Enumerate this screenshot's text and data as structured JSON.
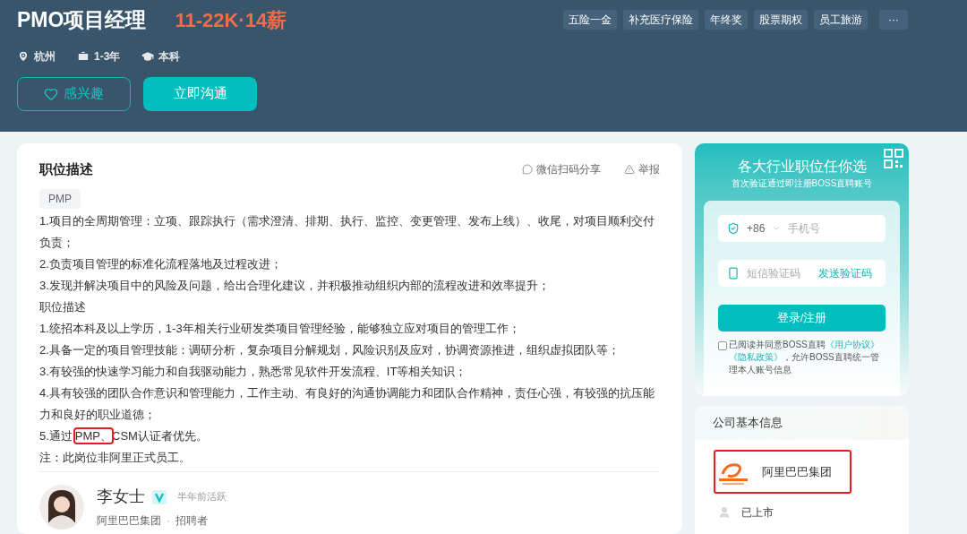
{
  "job": {
    "title": "PMO项目经理",
    "salary": "11-22K·14薪",
    "benefits": [
      "五险一金",
      "补充医疗保险",
      "年终奖",
      "股票期权",
      "员工旅游"
    ],
    "more": "···",
    "facts": [
      {
        "kind": "location",
        "text": "杭州"
      },
      {
        "kind": "experience",
        "text": "1-3年"
      },
      {
        "kind": "degree",
        "text": "本科"
      }
    ],
    "interest_button": "感兴趣",
    "chat_button": "立即沟通"
  },
  "description": {
    "title": "职位描述",
    "share": "微信扫码分享",
    "report": "举报",
    "tag": "PMP",
    "lines": [
      {
        "text": "1.项目的全周期管理：立项、跟踪执行（需求澄清、排期、执行、监控、变更管理、发布上线）、收尾，对项目顺利交付负责；"
      },
      {
        "text": "2.负责项目管理的标准化流程落地及过程改进；"
      },
      {
        "text": "3.发现并解决项目中的风险及问题，给出合理化建议，并积极推动组织内部的流程改进和效率提升；"
      },
      {
        "text": "职位描述"
      },
      {
        "text": "1.统招本科及以上学历，1-3年相关行业研发类项目管理经验，能够独立应对项目的管理工作；"
      },
      {
        "text": "2.具备一定的项目管理技能：调研分析，复杂项目分解规划，风险识别及应对，协调资源推进，组织虚拟团队等；"
      },
      {
        "text": "3.有较强的快速学习能力和自我驱动能力，熟悉常见软件开发流程、IT等相关知识；"
      },
      {
        "text": "4.具有较强的团队合作意识和管理能力，工作主动、有良好的沟通协调能力和团队合作精神，责任心强，有较强的抗压能力和良好的职业道德；"
      },
      {
        "text": "5.通过",
        "highlighted": "PMP、",
        "after": "CSM认证者优先。"
      },
      {
        "text": "注：此岗位非阿里正式员工。"
      }
    ]
  },
  "recruiter": {
    "name": "李女士",
    "verified": true,
    "active": "半年前活跃",
    "company": "阿里巴巴集团",
    "separator": "·",
    "role": "招聘者"
  },
  "login": {
    "title": "各大行业职位任你选",
    "subtitle": "首次验证通过即注册BOSS直聘账号",
    "country_code": "+86",
    "phone_placeholder": "手机号",
    "code_placeholder": "短信验证码",
    "send_code": "发送验证码",
    "submit": "登录/注册",
    "agree_checked": false,
    "agree_text": "已阅读并同意BOSS直聘",
    "terms_link": "《用户协议》",
    "privacy_link": "《隐私政策》",
    "agree_rest": "，允许BOSS直聘统一管理本人账号信息"
  },
  "company": {
    "title": "公司基本信息",
    "name": "阿里巴巴集团",
    "highlighted": true,
    "stage": "已上市"
  }
}
